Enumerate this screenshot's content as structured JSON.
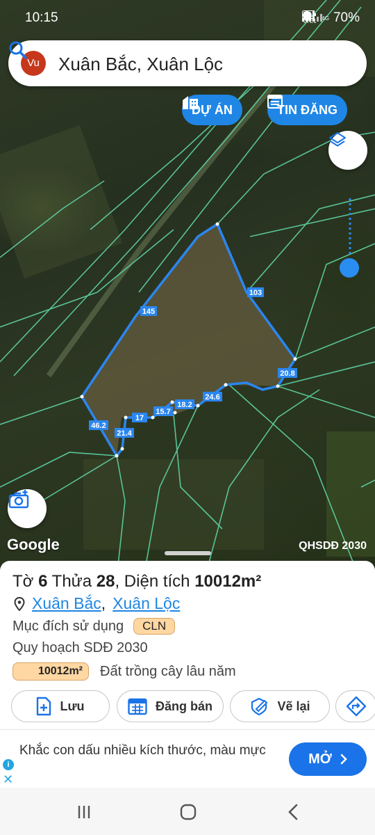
{
  "status_bar": {
    "time": "10:15",
    "network_label": "Vo) LTE1",
    "network_type": "4G",
    "battery": "70%"
  },
  "search": {
    "avatar": "Vu",
    "query": "Xuân Bắc, Xuân Lộc",
    "icon": "search-icon"
  },
  "chips": {
    "du_an": "DỰ ÁN",
    "tin_dang": "TIN ĐĂNG"
  },
  "map": {
    "edge_labels": [
      "145",
      "103",
      "20.8",
      "24.6",
      "18.2",
      "15.7",
      "17",
      "21.4",
      "46.2"
    ],
    "attribution": "Google",
    "plan_note": "QHSDĐ 2030",
    "colors": {
      "boundary": "#2b86ef",
      "label_bg": "#2b86ef",
      "parcel_lines": "#5fd3a5"
    }
  },
  "parcel": {
    "prefix_to": "Tờ ",
    "to_number": "6",
    "prefix_thua": " Thửa ",
    "thua_number": "28",
    "prefix_area": ", Diện tích ",
    "area": "10012m²",
    "location_a": "Xuân Bắc",
    "location_sep": ",",
    "location_b": "Xuân Lộc",
    "purpose_label": "Mục đích sử dụng",
    "purpose_code": "CLN",
    "plan_label": "Quy hoạch SDĐ 2030",
    "plan_area": "10012m²",
    "plan_desc": "Đất trồng cây lâu năm"
  },
  "actions": {
    "save": "Lưu",
    "sell": "Đăng bán",
    "redraw": "Vẽ lại"
  },
  "ad": {
    "text": "Khắc con dấu nhiều kích thước, màu mực",
    "button": "MỞ"
  }
}
